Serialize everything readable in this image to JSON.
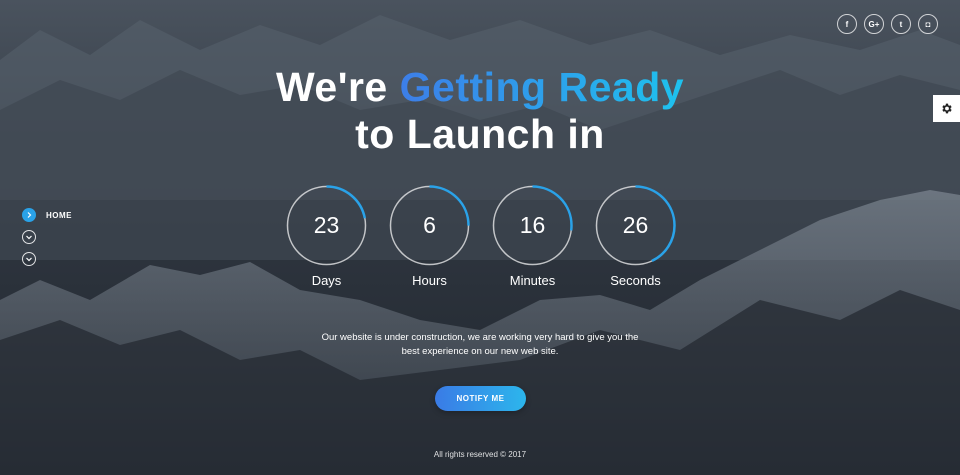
{
  "headline": {
    "line1_white": "We're",
    "line1_highlight": "Getting Ready",
    "line2": "to Launch in"
  },
  "countdown": [
    {
      "value": "23",
      "label": "Days",
      "progress": 0.22
    },
    {
      "value": "6",
      "label": "Hours",
      "progress": 0.25
    },
    {
      "value": "16",
      "label": "Minutes",
      "progress": 0.27
    },
    {
      "value": "26",
      "label": "Seconds",
      "progress": 0.43
    }
  ],
  "description": "Our website is under construction, we are working very hard to give you the best experience on our new web site.",
  "notify_button": "NOTIFY ME",
  "footer": "All rights reserved © 2017",
  "side_nav": [
    {
      "label": "HOME",
      "icon": "chevron-right-icon"
    },
    {
      "label": "",
      "icon": "chevron-down-icon"
    },
    {
      "label": "",
      "icon": "chevron-down-icon"
    }
  ],
  "social": [
    {
      "glyph": "f",
      "icon": "facebook-icon"
    },
    {
      "glyph": "G+",
      "icon": "google-plus-icon"
    },
    {
      "glyph": "t",
      "icon": "twitter-icon"
    },
    {
      "glyph": "◘",
      "icon": "instagram-icon"
    }
  ],
  "colors": {
    "accent": "#2aa2e8",
    "highlight_start": "#3d7ee8",
    "highlight_end": "#1ec2ee"
  }
}
